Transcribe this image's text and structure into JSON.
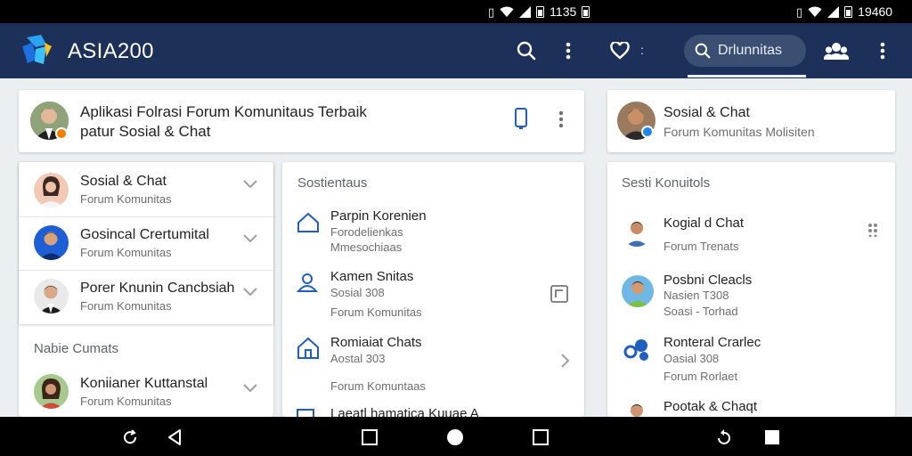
{
  "status_bar": {
    "left_time": "1135",
    "right_time": "19460"
  },
  "app_bar": {
    "title": "ASIA200",
    "search_label": "Drlunnitas",
    "heart_suffix": ":"
  },
  "header_card": {
    "line1": "Aplikasi Folrasi Forum Komunitaus Terbaik",
    "line2": "patur Sosial & Chat"
  },
  "profile_card": {
    "title": "Sosial & Chat",
    "subtitle": "Forum Komunitas Molisiten"
  },
  "left_list": {
    "items": [
      {
        "title": "Sosial & Chat",
        "subtitle": "Forum Komunitas"
      },
      {
        "title": "Gosincal Crertumital",
        "subtitle": "Forum Komunitas"
      },
      {
        "title": "Porer Knunin Cancbsiah",
        "subtitle": "Forum Komunitas"
      }
    ],
    "section_heading": "Nabie Cumats",
    "section_item": {
      "title": "Koniianer Kuttanstal",
      "subtitle": "Forum Komunitas"
    }
  },
  "middle_list": {
    "heading": "Sostientaus",
    "items": [
      {
        "title": "Parpin Korenien",
        "line2": "Forodelienkas",
        "line3": "Mmesochiaas"
      },
      {
        "title": "Kamen Snitas",
        "line2": "Sosial 308",
        "line3": "Forum Komunitas"
      },
      {
        "title": "Romiaiat Chats",
        "line2": "Aostal 303",
        "line3": "Forum Komuntaas"
      }
    ],
    "partial_item": "Laeatl hamatica Kuuae A"
  },
  "right_list": {
    "heading": "Sesti Konuitols",
    "items": [
      {
        "title": "Kogial d Chat",
        "line2": "Forum Trenats",
        "line3": ""
      },
      {
        "title": "Posbni Cleacls",
        "line2": "Nasien T308",
        "line3": "Soasi - Torhad"
      },
      {
        "title": "Ronteral Crarlec",
        "line2": "Oasial 308",
        "line3": "Forum Rorlaet"
      },
      {
        "title": "Pootak & Chaqt",
        "line2": "",
        "line3": ""
      }
    ]
  },
  "colors": {
    "app_bar": "#1c3059",
    "accent_blue": "#1f5fbf",
    "badge_orange": "#f57c00",
    "badge_blue": "#1e88e5"
  },
  "icons": [
    "wifi-icon",
    "signal-icon",
    "battery-icon",
    "search-icon",
    "more-vert-icon",
    "heart-icon",
    "group-icon",
    "phone-icon",
    "home-icon",
    "user-icon",
    "chevron-down-icon",
    "chevron-right-icon",
    "grid-dots-icon",
    "back-icon",
    "recents-icon",
    "rotate-icon"
  ]
}
